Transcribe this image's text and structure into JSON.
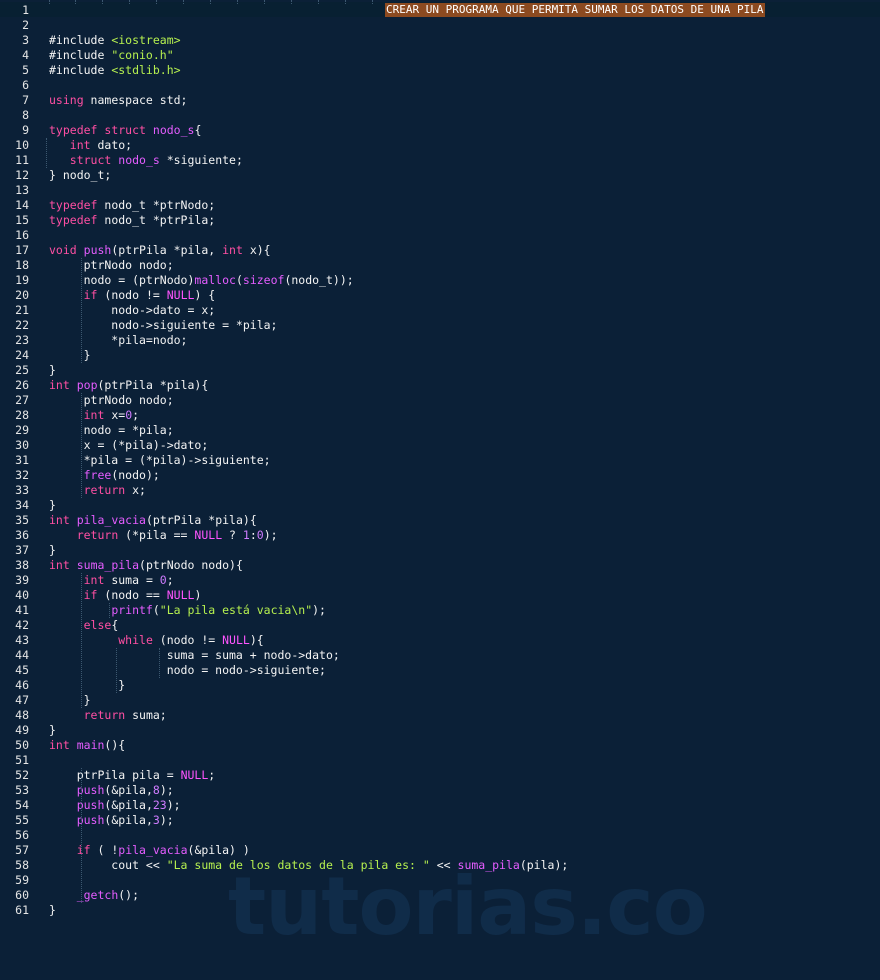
{
  "editor": {
    "lines": [
      {
        "n": "1",
        "t": []
      },
      {
        "n": "2",
        "t": []
      },
      {
        "n": "3",
        "t": [
          [
            "p",
            "#include "
          ],
          [
            "inc",
            "<iostream>"
          ]
        ]
      },
      {
        "n": "4",
        "t": [
          [
            "p",
            "#include "
          ],
          [
            "str",
            "\"conio.h\""
          ]
        ]
      },
      {
        "n": "5",
        "t": [
          [
            "p",
            "#include "
          ],
          [
            "inc",
            "<stdlib.h>"
          ]
        ]
      },
      {
        "n": "6",
        "t": []
      },
      {
        "n": "7",
        "t": [
          [
            "kw",
            "using"
          ],
          [
            "p",
            " namespace std;"
          ]
        ]
      },
      {
        "n": "8",
        "t": []
      },
      {
        "n": "9",
        "t": [
          [
            "kw",
            "typedef"
          ],
          [
            "p",
            " "
          ],
          [
            "kw",
            "struct"
          ],
          [
            "p",
            " "
          ],
          [
            "fn",
            "nodo_s"
          ],
          [
            "p",
            "{"
          ]
        ]
      },
      {
        "n": "10",
        "t": [
          [
            "p",
            "   "
          ],
          [
            "kw",
            "int"
          ],
          [
            "p",
            " dato;"
          ]
        ]
      },
      {
        "n": "11",
        "t": [
          [
            "p",
            "   "
          ],
          [
            "kw",
            "struct"
          ],
          [
            "p",
            " "
          ],
          [
            "fn",
            "nodo_s"
          ],
          [
            "p",
            " *siguiente;"
          ]
        ]
      },
      {
        "n": "12",
        "t": [
          [
            "p",
            "} nodo_t;"
          ]
        ]
      },
      {
        "n": "13",
        "t": []
      },
      {
        "n": "14",
        "t": [
          [
            "kw",
            "typedef"
          ],
          [
            "p",
            " nodo_t *ptrNodo;"
          ]
        ]
      },
      {
        "n": "15",
        "t": [
          [
            "kw",
            "typedef"
          ],
          [
            "p",
            " nodo_t *ptrPila;"
          ]
        ]
      },
      {
        "n": "16",
        "t": []
      },
      {
        "n": "17",
        "t": [
          [
            "kw",
            "void"
          ],
          [
            "p",
            " "
          ],
          [
            "fn",
            "push"
          ],
          [
            "p",
            "(ptrPila *pila, "
          ],
          [
            "kw",
            "int"
          ],
          [
            "p",
            " x){"
          ]
        ]
      },
      {
        "n": "18",
        "t": [
          [
            "p",
            "     ptrNodo nodo;"
          ]
        ]
      },
      {
        "n": "19",
        "t": [
          [
            "p",
            "     nodo = (ptrNodo)"
          ],
          [
            "fn",
            "malloc"
          ],
          [
            "p",
            "("
          ],
          [
            "fn",
            "sizeof"
          ],
          [
            "p",
            "(nodo_t));"
          ]
        ]
      },
      {
        "n": "20",
        "t": [
          [
            "p",
            "     "
          ],
          [
            "kw",
            "if"
          ],
          [
            "p",
            " (nodo != "
          ],
          [
            "nul",
            "NULL"
          ],
          [
            "p",
            ") {"
          ]
        ]
      },
      {
        "n": "21",
        "t": [
          [
            "p",
            "         nodo->dato = x;"
          ]
        ]
      },
      {
        "n": "22",
        "t": [
          [
            "p",
            "         nodo->siguiente = *pila;"
          ]
        ]
      },
      {
        "n": "23",
        "t": [
          [
            "p",
            "         *pila=nodo;"
          ]
        ]
      },
      {
        "n": "24",
        "t": [
          [
            "p",
            "     }"
          ]
        ]
      },
      {
        "n": "25",
        "t": [
          [
            "p",
            "}"
          ]
        ]
      },
      {
        "n": "26",
        "t": [
          [
            "kw",
            "int"
          ],
          [
            "p",
            " "
          ],
          [
            "fn",
            "pop"
          ],
          [
            "p",
            "(ptrPila *pila){"
          ]
        ]
      },
      {
        "n": "27",
        "t": [
          [
            "p",
            "     ptrNodo nodo;"
          ]
        ]
      },
      {
        "n": "28",
        "t": [
          [
            "p",
            "     "
          ],
          [
            "kw",
            "int"
          ],
          [
            "p",
            " x="
          ],
          [
            "num",
            "0"
          ],
          [
            "p",
            ";"
          ]
        ]
      },
      {
        "n": "29",
        "t": [
          [
            "p",
            "     nodo = *pila;"
          ]
        ]
      },
      {
        "n": "30",
        "t": [
          [
            "p",
            "     x = (*pila)->dato;"
          ]
        ]
      },
      {
        "n": "31",
        "t": [
          [
            "p",
            "     *pila = (*pila)->siguiente;"
          ]
        ]
      },
      {
        "n": "32",
        "t": [
          [
            "p",
            "     "
          ],
          [
            "fn",
            "free"
          ],
          [
            "p",
            "(nodo);"
          ]
        ]
      },
      {
        "n": "33",
        "t": [
          [
            "p",
            "     "
          ],
          [
            "kw",
            "return"
          ],
          [
            "p",
            " x;"
          ]
        ]
      },
      {
        "n": "34",
        "t": [
          [
            "p",
            "}"
          ]
        ]
      },
      {
        "n": "35",
        "t": [
          [
            "kw",
            "int"
          ],
          [
            "p",
            " "
          ],
          [
            "fn",
            "pila_vacia"
          ],
          [
            "p",
            "(ptrPila *pila){"
          ]
        ]
      },
      {
        "n": "36",
        "t": [
          [
            "p",
            "    "
          ],
          [
            "kw",
            "return"
          ],
          [
            "p",
            " (*pila == "
          ],
          [
            "nul",
            "NULL"
          ],
          [
            "p",
            " ? "
          ],
          [
            "num",
            "1"
          ],
          [
            "p",
            ":"
          ],
          [
            "num",
            "0"
          ],
          [
            "p",
            ");"
          ]
        ]
      },
      {
        "n": "37",
        "t": [
          [
            "p",
            "}"
          ]
        ]
      },
      {
        "n": "38",
        "t": [
          [
            "kw",
            "int"
          ],
          [
            "p",
            " "
          ],
          [
            "fn",
            "suma_pila"
          ],
          [
            "p",
            "(ptrNodo nodo){"
          ]
        ]
      },
      {
        "n": "39",
        "t": [
          [
            "p",
            "     "
          ],
          [
            "kw",
            "int"
          ],
          [
            "p",
            " suma = "
          ],
          [
            "num",
            "0"
          ],
          [
            "p",
            ";"
          ]
        ]
      },
      {
        "n": "40",
        "t": [
          [
            "p",
            "     "
          ],
          [
            "kw",
            "if"
          ],
          [
            "p",
            " (nodo == "
          ],
          [
            "nul",
            "NULL"
          ],
          [
            "p",
            ")"
          ]
        ]
      },
      {
        "n": "41",
        "t": [
          [
            "p",
            "         "
          ],
          [
            "fn",
            "printf"
          ],
          [
            "p",
            "("
          ],
          [
            "str",
            "\"La pila está vacia\\n\""
          ],
          [
            "p",
            ");"
          ]
        ]
      },
      {
        "n": "42",
        "t": [
          [
            "p",
            "     "
          ],
          [
            "kw",
            "else"
          ],
          [
            "p",
            "{"
          ]
        ]
      },
      {
        "n": "43",
        "t": [
          [
            "p",
            "          "
          ],
          [
            "kw",
            "while"
          ],
          [
            "p",
            " (nodo != "
          ],
          [
            "nul",
            "NULL"
          ],
          [
            "p",
            "){"
          ]
        ]
      },
      {
        "n": "44",
        "t": [
          [
            "p",
            "                 suma = suma + nodo->dato;"
          ]
        ]
      },
      {
        "n": "45",
        "t": [
          [
            "p",
            "                 nodo = nodo->siguiente;"
          ]
        ]
      },
      {
        "n": "46",
        "t": [
          [
            "p",
            "          }"
          ]
        ]
      },
      {
        "n": "47",
        "t": [
          [
            "p",
            "     }"
          ]
        ]
      },
      {
        "n": "48",
        "t": [
          [
            "p",
            "     "
          ],
          [
            "kw",
            "return"
          ],
          [
            "p",
            " suma;"
          ]
        ]
      },
      {
        "n": "49",
        "t": [
          [
            "p",
            "}"
          ]
        ]
      },
      {
        "n": "50",
        "t": [
          [
            "kw",
            "int"
          ],
          [
            "p",
            " "
          ],
          [
            "fn",
            "main"
          ],
          [
            "p",
            "(){"
          ]
        ]
      },
      {
        "n": "51",
        "t": []
      },
      {
        "n": "52",
        "t": [
          [
            "p",
            "    ptrPila pila = "
          ],
          [
            "nul",
            "NULL"
          ],
          [
            "p",
            ";"
          ]
        ]
      },
      {
        "n": "53",
        "t": [
          [
            "p",
            "    "
          ],
          [
            "fn",
            "push"
          ],
          [
            "p",
            "(&pila,"
          ],
          [
            "num",
            "8"
          ],
          [
            "p",
            ");"
          ]
        ]
      },
      {
        "n": "54",
        "t": [
          [
            "p",
            "    "
          ],
          [
            "fn",
            "push"
          ],
          [
            "p",
            "(&pila,"
          ],
          [
            "num",
            "23"
          ],
          [
            "p",
            ");"
          ]
        ]
      },
      {
        "n": "55",
        "t": [
          [
            "p",
            "    "
          ],
          [
            "fn",
            "push"
          ],
          [
            "p",
            "(&pila,"
          ],
          [
            "num",
            "3"
          ],
          [
            "p",
            ");"
          ]
        ]
      },
      {
        "n": "56",
        "t": []
      },
      {
        "n": "57",
        "t": [
          [
            "p",
            "    "
          ],
          [
            "kw",
            "if"
          ],
          [
            "p",
            " ( !"
          ],
          [
            "fn",
            "pila_vacia"
          ],
          [
            "p",
            "(&pila) )"
          ]
        ]
      },
      {
        "n": "58",
        "t": [
          [
            "p",
            "         cout << "
          ],
          [
            "str",
            "\"La suma de los datos de la pila es: \""
          ],
          [
            "p",
            " << "
          ],
          [
            "fn",
            "suma_pila"
          ],
          [
            "p",
            "(pila);"
          ]
        ]
      },
      {
        "n": "59",
        "t": []
      },
      {
        "n": "60",
        "t": [
          [
            "p",
            "    "
          ],
          [
            "fn",
            "_getch"
          ],
          [
            "p",
            "();"
          ]
        ]
      },
      {
        "n": "61",
        "t": [
          [
            "p",
            "}"
          ]
        ]
      }
    ],
    "line1_comment": "CREAR UN PROGRAMA QUE PERMITA SUMAR LOS DATOS DE UNA PILA",
    "watermark": "tutorias.co",
    "colors": {
      "background": "#0b2037",
      "keyword": "#ff4fa3",
      "function": "#e55dff",
      "string": "#b6f04f",
      "number": "#d07cff",
      "comment_highlight": "#8c4a20"
    }
  }
}
